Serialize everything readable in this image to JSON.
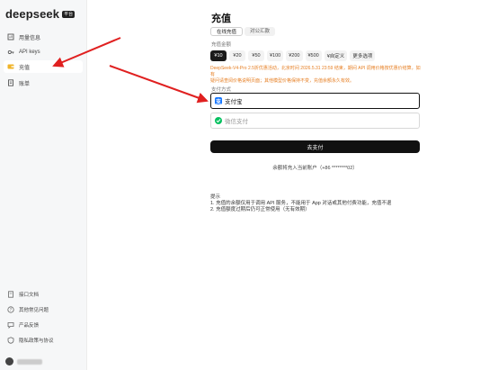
{
  "app": {
    "logo_text": "deepseek",
    "logo_badge": "平台"
  },
  "sidebar": {
    "items": [
      {
        "label": "用量信息",
        "icon": "usage-icon",
        "active": false
      },
      {
        "label": "API keys",
        "icon": "key-icon",
        "active": false
      },
      {
        "label": "充值",
        "icon": "wallet-icon",
        "active": true
      },
      {
        "label": "账单",
        "icon": "bill-icon",
        "active": false
      }
    ],
    "bottom_items": [
      {
        "label": "接口文档",
        "icon": "doc-icon"
      },
      {
        "label": "其他常见问题",
        "icon": "help-icon"
      },
      {
        "label": "产品反馈",
        "icon": "feedback-icon"
      },
      {
        "label": "隐私政策与协议",
        "icon": "privacy-icon"
      }
    ]
  },
  "main": {
    "title": "充值",
    "tabs": [
      {
        "label": "在线充值",
        "active": true
      },
      {
        "label": "对公汇款",
        "active": false
      }
    ],
    "amount_label": "充值金额",
    "amounts": [
      {
        "label": "¥10",
        "active": true
      },
      {
        "label": "¥20",
        "active": false
      },
      {
        "label": "¥50",
        "active": false
      },
      {
        "label": "¥100",
        "active": false
      },
      {
        "label": "¥200",
        "active": false
      },
      {
        "label": "¥500",
        "active": false
      },
      {
        "label": "¥自定义",
        "active": false
      },
      {
        "label": "更多选项",
        "active": false
      }
    ],
    "notice_line1": "DeepSeek-V4-Pro 2.5折优惠活动，北京时间 2026.5.31 23:59 结束，期间 API 调用价格按优惠价结算，如有",
    "notice_line2": "疑问请查阅价格说明页面；其他模型价格保持不变，充值余额永久有效。",
    "payment_label": "支付方式",
    "payment_options": [
      {
        "label": "支付宝",
        "icon": "alipay-icon",
        "selected": true,
        "icon_color": "#1677ff"
      },
      {
        "label": "微信支付",
        "icon": "wechat-pay-icon",
        "selected": false,
        "icon_color": "#07c160"
      }
    ],
    "pay_button": "去支付",
    "account_text": "余额将充入当前账户（+86 ********02）",
    "tips_title": "提示",
    "tips": [
      "1. 充值的余额仅用于调用 API 服务，不能用于 App 对话或其他付费功能，充值不退",
      "2. 充值额度过期后仍可正常使用（无有效期）"
    ]
  },
  "colors": {
    "accent": "#111111",
    "notice": "#e67e22",
    "arrow": "#e02020"
  }
}
